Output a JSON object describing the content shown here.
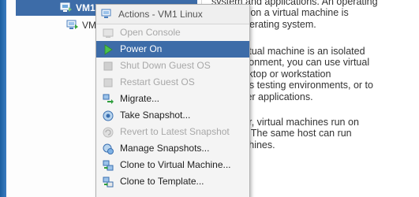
{
  "navigator": {
    "selected_item": "VM1 Linux",
    "selected_item_visible": "VM1 Li",
    "second_item_visible": "VMw"
  },
  "content": {
    "lines": [
      "system and applications. An operating",
      "installed on a virtual machine is",
      "guest operating system.",
      "every virtual machine is an isolated",
      "ing environment, you can use virtual",
      "s as desktop or workstation",
      "ments, as testing environments, or to",
      "ate server applications.",
      "er Server, virtual machines run on",
      "clusters. The same host can run",
      "tual machines."
    ]
  },
  "context_menu": {
    "header": "Actions - VM1 Linux",
    "items": [
      {
        "label": "Open Console",
        "enabled": false,
        "icon": "console-icon"
      },
      {
        "label": "Power On",
        "enabled": true,
        "icon": "play-icon",
        "highlighted": true
      },
      {
        "label": "Shut Down Guest OS",
        "enabled": false,
        "icon": "shutdown-icon"
      },
      {
        "label": "Restart Guest OS",
        "enabled": false,
        "icon": "restart-icon"
      },
      {
        "label": "Migrate...",
        "enabled": true,
        "icon": "migrate-icon"
      },
      {
        "label": "Take Snapshot...",
        "enabled": true,
        "icon": "snapshot-icon"
      },
      {
        "label": "Revert to Latest Snapshot",
        "enabled": false,
        "icon": "revert-snapshot-icon"
      },
      {
        "label": "Manage Snapshots...",
        "enabled": true,
        "icon": "manage-snapshots-icon"
      },
      {
        "label": "Clone to Virtual Machine...",
        "enabled": true,
        "icon": "clone-vm-icon"
      },
      {
        "label": "Clone to Template...",
        "enabled": true,
        "icon": "clone-template-icon"
      }
    ]
  },
  "colors": {
    "selection": "#3d6ca8",
    "menu_bg": "#f4f4f4",
    "disabled_text": "#a8a8a8",
    "play_green": "#2e9e3c"
  }
}
